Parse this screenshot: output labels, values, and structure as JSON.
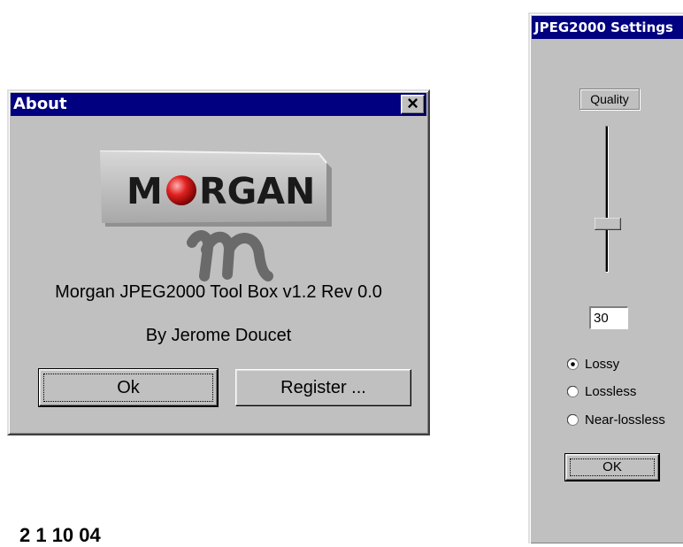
{
  "about_dialog": {
    "title": "About",
    "close_glyph": "×",
    "logo": {
      "text": "MORGAN",
      "icon": "morgan-logo-icon"
    },
    "product_line": "Morgan JPEG2000 Tool Box v1.2 Rev 0.0",
    "author_line": "By Jerome Doucet",
    "ok_label": "Ok",
    "register_label": "Register ..."
  },
  "settings_dialog": {
    "title": "JPEG2000 Settings",
    "quality_label": "Quality",
    "quality_value": "30",
    "slider_icon": "slider-thumb-icon",
    "options": [
      {
        "label": "Lossy",
        "selected": true
      },
      {
        "label": "Lossless",
        "selected": false
      },
      {
        "label": "Near-lossless",
        "selected": false
      }
    ],
    "ok_label": "OK"
  },
  "footer": {
    "date_text": "2 1 10 04"
  },
  "colors": {
    "titlebar": "#000080",
    "face": "#c0c0c0",
    "logo_red": "#d01010"
  }
}
